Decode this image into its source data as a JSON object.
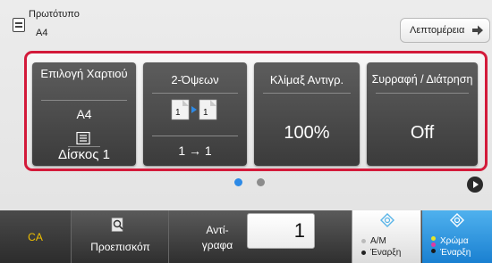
{
  "header": {
    "original_label": "Πρωτότυπο",
    "original_size": "A4",
    "details_label": "Λεπτομέρεια"
  },
  "function_keys": [
    {
      "title": "Επιλογή Χαρτιού",
      "value_top": "A4",
      "value_bottom": "Δίσκος 1"
    },
    {
      "title": "2-Όψεων",
      "value": "1 → 1"
    },
    {
      "title": "Κλίμαξ Αντιγρ.",
      "value": "100%"
    },
    {
      "title": "Συρραφή / Διάτρηση",
      "value": "Off"
    }
  ],
  "pager": {
    "current_page": 1,
    "total_pages": 2
  },
  "bottom": {
    "ca_label": "CA",
    "preview_label": "Προεπισκόπ",
    "copies_label": "Αντί- γραφα",
    "copies_value": "1",
    "bw_start_line1": "A/M",
    "bw_start_line2": "Έναρξη",
    "color_start_line1": "Χρώμα",
    "color_start_line2": "Έναρξη"
  },
  "colors": {
    "highlight_border": "#d31a3a",
    "key_background": "#4a4a4a",
    "active_dot": "#2d8ae6",
    "ca_text": "#f0c000",
    "color_start_bg": "#2f95e0"
  },
  "icons": {
    "original": "document-icon",
    "details": "arrow-right-icon",
    "tray": "paper-tray-icon",
    "duplex": "duplex-pages-icon",
    "preview": "magnifier-icon",
    "start": "start-diamond-icon"
  }
}
